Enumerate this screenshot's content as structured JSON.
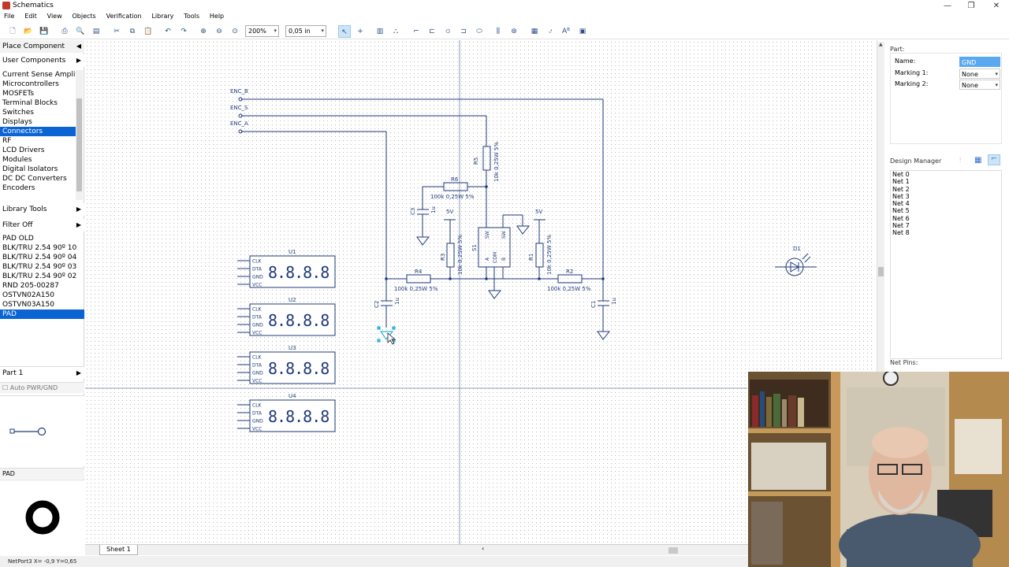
{
  "window": {
    "title": "Schematics"
  },
  "menu": [
    "File",
    "Edit",
    "View",
    "Objects",
    "Verification",
    "Library",
    "Tools",
    "Help"
  ],
  "toolbar": {
    "zoom": "200%",
    "grid": "0,05 in"
  },
  "left_panel": {
    "place_component": "Place Component",
    "user_components": "User Components",
    "categories": [
      "Current Sense Amplifi",
      "Microcontrollers",
      "MOSFETs",
      "Terminal Blocks",
      "Switches",
      "Displays",
      "Connectors",
      "RF",
      "LCD Drivers",
      "Modules",
      "Digital Isolators",
      "DC DC Converters",
      "Encoders"
    ],
    "selected_category": "Connectors",
    "library_tools": "Library Tools",
    "filter": "Filter Off",
    "components": [
      "PAD OLD",
      "BLK/TRU 2.54 90º 10",
      "BLK/TRU 2.54 90º 04",
      "BLK/TRU 2.54 90º 03",
      "BLK/TRU 2.54 90º 02",
      "RND 205-00287",
      "OSTVN02A150",
      "OSTVN03A150",
      "PAD"
    ],
    "selected_component": "PAD",
    "part": "Part 1",
    "auto_pwr": "Auto PWR/GND",
    "preview_name": "PAD"
  },
  "right_panel": {
    "part_label": "Part:",
    "name_label": "Name:",
    "name_value": "GND",
    "marking1_label": "Marking 1:",
    "marking1_value": "None",
    "marking2_label": "Marking 2:",
    "marking2_value": "None",
    "design_manager": "Design Manager",
    "nets": [
      "Net 0",
      "Net 1",
      "Net 2",
      "Net 3",
      "Net 4",
      "Net 5",
      "Net 6",
      "Net 7",
      "Net 8"
    ],
    "net_pins": "Net Pins:"
  },
  "schematic": {
    "ports": [
      "ENC_B",
      "ENC_S",
      "ENC_A"
    ],
    "displays": [
      "U1",
      "U2",
      "U3",
      "U4"
    ],
    "display_pins": [
      "CLK",
      "DTA",
      "GND",
      "VCC"
    ],
    "digits": "8.8.8.8",
    "resistors": [
      {
        "ref": "R5",
        "value": "10k 0,25W 5%"
      },
      {
        "ref": "R6",
        "value": "100k 0,25W 5%"
      },
      {
        "ref": "R3",
        "value": "10k 0,25W 5%"
      },
      {
        "ref": "R4",
        "value": "100k 0,25W 5%"
      },
      {
        "ref": "R1",
        "value": "10k 0,25W 5%"
      },
      {
        "ref": "R2",
        "value": "100k 0,25W 5%"
      }
    ],
    "capacitors": [
      {
        "ref": "C3",
        "value": "1u"
      },
      {
        "ref": "C2",
        "value": "1u"
      },
      {
        "ref": "C1",
        "value": "1u"
      }
    ],
    "switch": {
      "ref": "S1",
      "pins": [
        "SW",
        "SW",
        "A",
        "COM",
        "B"
      ]
    },
    "led": "D1",
    "supply": "5V"
  },
  "sheet_tab": "Sheet 1",
  "status": "NetPort3   X= -0,9  Y=0,65",
  "colors": {
    "selection": "#0a64d4",
    "schematic": "#1f3a7a",
    "highlight": "#5aa9f0"
  }
}
